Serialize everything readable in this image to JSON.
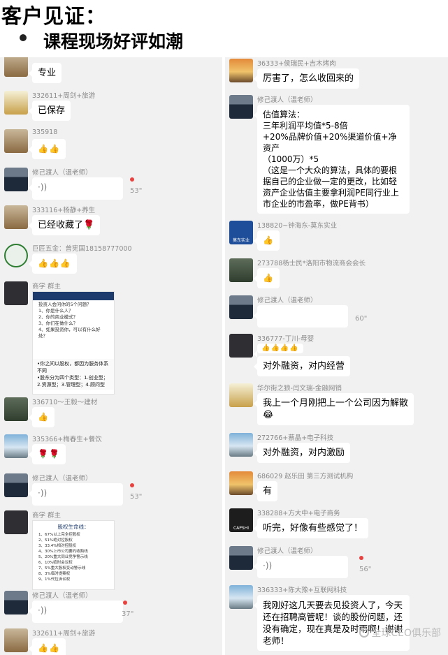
{
  "header": {
    "title": "客户见证：",
    "subtitle": "课程现场好评如潮"
  },
  "left": [
    {
      "sender": "",
      "text": "专业"
    },
    {
      "sender": "332611+周剑+旅游",
      "text": "已保存"
    },
    {
      "sender": "335918",
      "text": "👍👍"
    },
    {
      "sender": "修己渡人（温老师）",
      "voice": "·))",
      "duration": "53\""
    },
    {
      "sender": "333116+杨静+养生",
      "text": "已经收藏了🌹"
    },
    {
      "sender": "巨匠五金：曾宪国18158777000",
      "text": "👍👍👍"
    },
    {
      "sender": "商学 群主",
      "image_lines": "投资人会问你的5个问题？\n1、你是什么人？\n2、你的商业模式？\n3、你们在做什么？\n4、如果投资你，可以有什么好处？",
      "image_strip": "•你之间以股权，都因为服务体系不同\n•股东分为四个类型：1.创业型；2.资源型；3.管理型；4.顾问型"
    },
    {
      "sender": "336710～王毅～建材",
      "text": "👍"
    },
    {
      "sender": "335366+梅春生+餐饮",
      "text": "🌹🌹"
    },
    {
      "sender": "修己渡人（温老师）",
      "voice": "·))",
      "duration": "53\""
    },
    {
      "sender": "商学 群主",
      "chart_title": "股权生命线：",
      "chart_lines": "1、67%以上完全控股权\n2、51%绝对控股权\n3、33.4%相对控股权\n4、30%上市公司要约收购线\n5、20%重大同业竞争警示线\n6、10%临时会议权\n7、5%重大股权变动警示线\n8、3%临时提案权\n9、1%代位诉讼权"
    },
    {
      "sender": "修己渡人（温老师）",
      "voice": "·))",
      "duration": "37\""
    },
    {
      "sender": "332611+周剑+旅游",
      "text": "👍👍"
    }
  ],
  "right": [
    {
      "sender": "36333+侯瑞民+吉木烤肉",
      "text": "厉害了，怎么收回来的"
    },
    {
      "sender": "修己渡人（温老师）",
      "text": "估值算法：\n三年利润平均值*5-8倍\n+20%品牌价值+20%渠道价值+净资产\n（1000万）*5\n（这是一个大众的算法，具体的要根据自己的企业做一定的更改，比如轻资产企业估值主要拿利润PE同行业上市企业的市盈率，做PE背书）"
    },
    {
      "sender": "138820~钟海东-莫东实业",
      "text": "👍"
    },
    {
      "sender": "273788杨士民*洛阳市物流商会会长",
      "text": "👍"
    },
    {
      "sender": "修己渡人（温老师）",
      "voice": "",
      "duration": "60\""
    },
    {
      "sender": "336777-丁川-母婴",
      "text": "👍👍👍👍"
    },
    {
      "sender": "",
      "text": "对外融资，对内经营"
    },
    {
      "sender": "华尔街之狼-闫文瑞-金融网销",
      "text": "我上一个月刚把上一个公司因为解散\n😂"
    },
    {
      "sender": "272766+蔡晶+电子科技",
      "text": "对外融资，对内激励"
    },
    {
      "sender": "686029 赵乐田 第三方测试机构",
      "text": "有"
    },
    {
      "sender": "338288+方大中+电子商务",
      "text": "听完，好像有些感觉了！"
    },
    {
      "sender": "修己渡人（温老师）",
      "voice": "·))",
      "duration": "56\""
    },
    {
      "sender": "336333+陈大豫+互联网科技",
      "text": "我刚好这几天要去见投资人了，今天还在招聘高管呢！谈的股份问题，还没有确定，现在真是及时雨啊！谢谢老师！"
    }
  ],
  "avatar_labels": {
    "brand": "莫东实业",
    "capital": "CAPSHI"
  },
  "watermark": "全球CEO俱乐部"
}
